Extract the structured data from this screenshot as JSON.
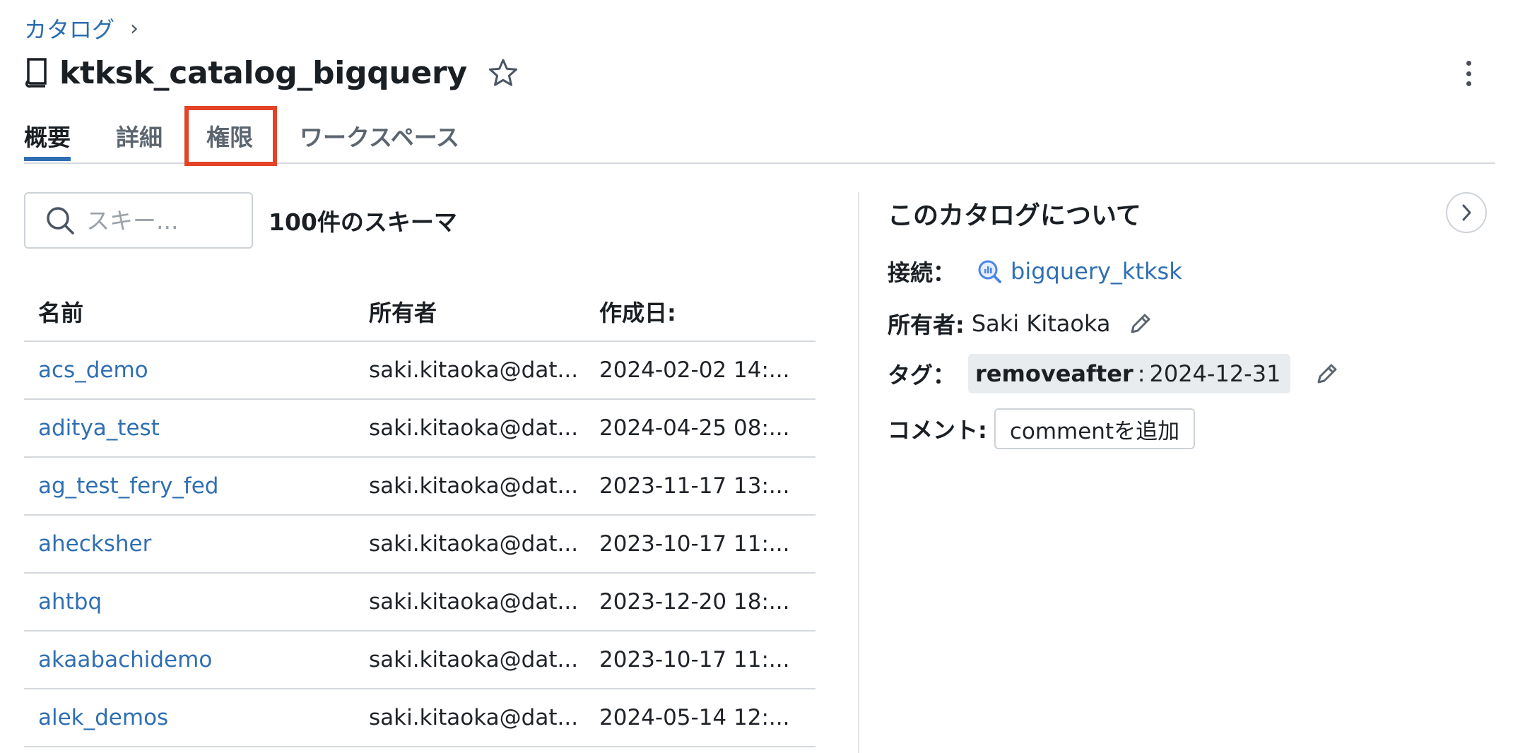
{
  "breadcrumb": {
    "root": "カタログ",
    "separator": "›"
  },
  "header": {
    "title": "ktksk_catalog_bigquery"
  },
  "tabs": [
    {
      "label": "概要",
      "active": true
    },
    {
      "label": "詳細",
      "active": false
    },
    {
      "label": "権限",
      "active": false,
      "highlighted": true
    },
    {
      "label": "ワークスペース",
      "active": false
    }
  ],
  "search": {
    "placeholder": "スキー..."
  },
  "schema_count": "100件のスキーマ",
  "table": {
    "columns": [
      "名前",
      "所有者",
      "作成日:"
    ],
    "rows": [
      {
        "name": "acs_demo",
        "owner": "saki.kitaoka@dat...",
        "created": "2024-02-02 14:..."
      },
      {
        "name": "aditya_test",
        "owner": "saki.kitaoka@dat...",
        "created": "2024-04-25 08:..."
      },
      {
        "name": "ag_test_fery_fed",
        "owner": "saki.kitaoka@dat...",
        "created": "2023-11-17 13:..."
      },
      {
        "name": "ahecksher",
        "owner": "saki.kitaoka@dat...",
        "created": "2023-10-17 11:..."
      },
      {
        "name": "ahtbq",
        "owner": "saki.kitaoka@dat...",
        "created": "2023-12-20 18:..."
      },
      {
        "name": "akaabachidemo",
        "owner": "saki.kitaoka@dat...",
        "created": "2023-10-17 11:..."
      },
      {
        "name": "alek_demos",
        "owner": "saki.kitaoka@dat...",
        "created": "2024-05-14 12:..."
      }
    ]
  },
  "about": {
    "title": "このカタログについて",
    "connection_label": "接続：",
    "connection_value": "bigquery_ktksk",
    "owner_label": "所有者:",
    "owner_value": "Saki Kitaoka",
    "tags_label": "タグ：",
    "tag_key": "removeafter",
    "tag_separator": ":",
    "tag_value": "2024-12-31",
    "comment_label": "コメント:",
    "add_comment_label": "commentを追加"
  },
  "colors": {
    "link": "#2f6fb3",
    "highlight": "#e34326",
    "tab_active": "#2f6fb3"
  },
  "icons": [
    "book-icon",
    "star-icon",
    "kebab-menu-icon",
    "search-icon",
    "bigquery-icon",
    "pencil-icon",
    "chevron-right-icon"
  ]
}
